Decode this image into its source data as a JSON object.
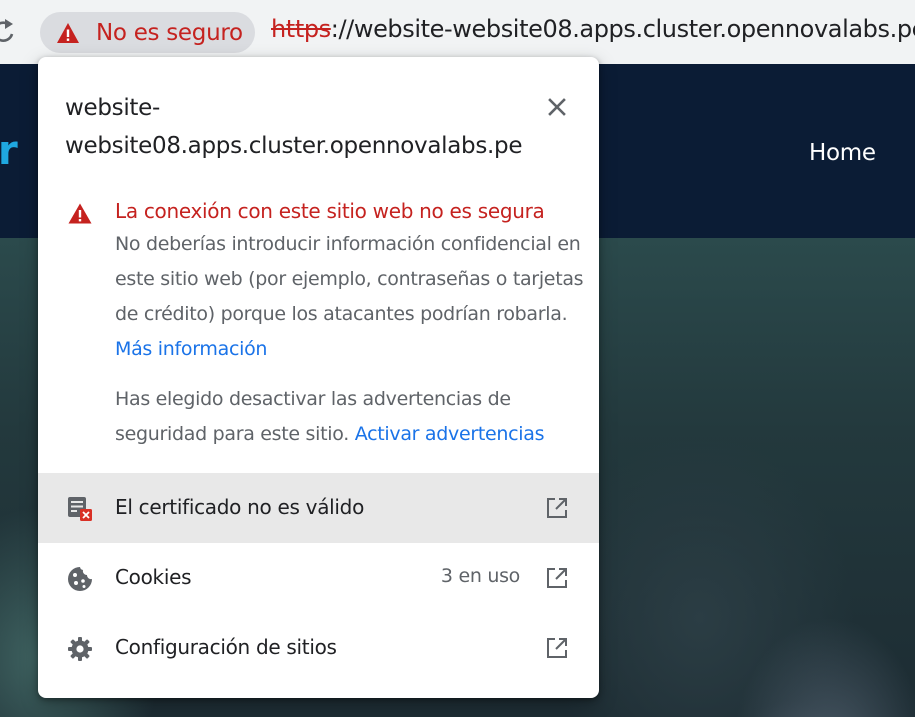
{
  "omnibox": {
    "chip_label": "No es seguro",
    "url_scheme": "https",
    "url_rest": "://website-website08.apps.cluster.opennovalabs.pe"
  },
  "page": {
    "nav_home": "Home"
  },
  "popup": {
    "title_line1": "website-",
    "title_line2": "website08.apps.cluster.opennovalabs.pe",
    "warning_heading": "La conexión con este sitio web no es segura",
    "warning_body": "No deberías introducir información confidencial en este sitio web (por ejemplo, contraseñas o tarjetas de crédito) porque los atacantes podrían robarla.",
    "more_info_link": "Más información",
    "disabled_note": "Has elegido desactivar las advertencias de seguridad para este sitio.",
    "enable_warnings_link": "Activar advertencias",
    "rows": [
      {
        "label": "El certificado no es válido",
        "icon": "certificate-error-icon"
      },
      {
        "label": "Cookies",
        "count": "3 en uso",
        "icon": "cookie-icon"
      },
      {
        "label": "Configuración de sitios",
        "icon": "gear-icon"
      }
    ]
  },
  "colors": {
    "danger": "#c5221f",
    "link": "#1a73e8",
    "secondary_text": "#5f6368",
    "highlight_row": "#e8e8e8"
  }
}
